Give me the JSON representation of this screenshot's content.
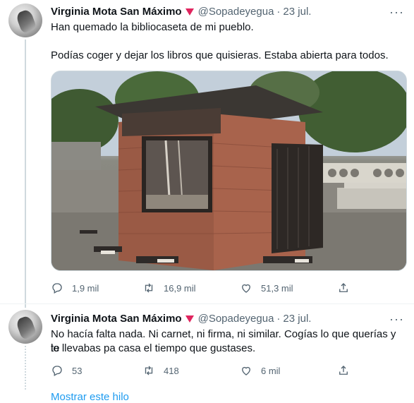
{
  "tweets": [
    {
      "author_name": "Virginia Mota San Máximo",
      "handle": "@Sopadeyegua",
      "separator": "·",
      "date": "23 jul.",
      "text_line1": "Han quemado la bibliocaseta de mi pueblo.",
      "text_line2": "Podías coger y dejar los libros que quisieras. Estaba abierta para todos.",
      "reply_count": "1,9 mil",
      "retweet_count": "16,9 mil",
      "like_count": "51,3 mil"
    },
    {
      "author_name": "Virginia Mota San Máximo",
      "handle": "@Sopadeyegua",
      "separator": "·",
      "date": "23 jul.",
      "text_line1": "No hacía falta nada. Ni carnet, ni firma, ni similar. Cogías lo que querías y te",
      "text_line2": "lo llevabas pa casa el tiempo que gustases.",
      "reply_count": "53",
      "retweet_count": "418",
      "like_count": "6 mil"
    }
  ],
  "show_thread_label": "Mostrar este hilo",
  "more_icon_glyph": "···",
  "colors": {
    "accent_blue": "#1d9bf0",
    "badge_red": "#e0245e",
    "secondary_text": "#536471"
  },
  "icons": [
    "reply-icon",
    "retweet-icon",
    "like-icon",
    "share-icon",
    "more-icon",
    "red-triangle-icon"
  ]
}
